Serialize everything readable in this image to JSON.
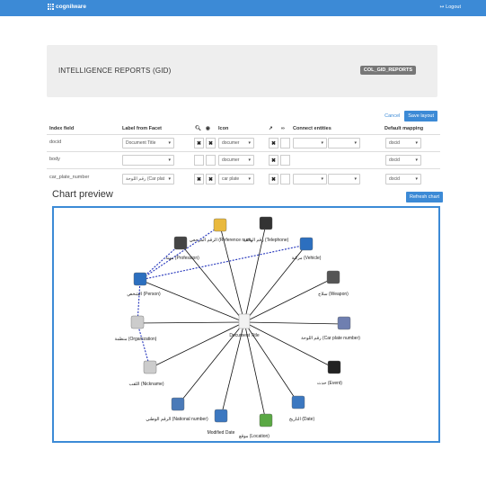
{
  "app": {
    "brand": "cognilware",
    "logout_label": "Logout"
  },
  "title_panel": {
    "title": "INTELLIGENCE REPORTS (GID)",
    "badge": "COL_GID_REPORTS"
  },
  "actions": {
    "cancel_label": "Cancel",
    "save_label": "Save layout"
  },
  "columns": {
    "index_field": "Index field",
    "label_from_facet": "Label from Facet",
    "icon": "Icon",
    "connect_entities": "Connect entities",
    "default_mapping": "Default mapping"
  },
  "rows": [
    {
      "index_field": "docid",
      "label": "Document Title",
      "icon": "documer",
      "mapping": "docid"
    },
    {
      "index_field": "body",
      "label": "",
      "icon": "documer",
      "mapping": "docid"
    },
    {
      "index_field": "car_plate_number",
      "label": "رقم اللوحة (Car plat",
      "icon": "car plate",
      "mapping": "docid"
    }
  ],
  "chart": {
    "title": "Chart preview",
    "refresh_label": "Refresh chart",
    "center_label": "Document Title",
    "nodes": [
      {
        "label": "الرقم المرجعي (Reference num",
        "icon": "folder-icon",
        "color": "#e9b93d"
      },
      {
        "label": "رقم الهاتف (Telephone)",
        "icon": "phone-icon",
        "color": "#333333"
      },
      {
        "label": "مركبة (Vehicle)",
        "icon": "car-icon",
        "color": "#2c6fbf"
      },
      {
        "label": "سلاح (Weapon)",
        "icon": "weapon-icon",
        "color": "#555555"
      },
      {
        "label": "رقم اللوحة (Car plate number)",
        "icon": "plate-icon",
        "color": "#6f7fb0"
      },
      {
        "label": "حدث (Event)",
        "icon": "clapper-icon",
        "color": "#222222"
      },
      {
        "label": "التاريخ (Date)",
        "icon": "calendar-icon",
        "color": "#3c78c0"
      },
      {
        "label": "موقع (Location)",
        "icon": "map-icon",
        "color": "#5aa844"
      },
      {
        "label": "Modified Date",
        "icon": "calendar-icon",
        "color": "#3c78c0"
      },
      {
        "label": "الرقم الوطني (National number)",
        "icon": "id-card-icon",
        "color": "#4a7ab8"
      },
      {
        "label": "اللقب (Nickname)",
        "icon": "document-icon",
        "color": "#cccccc"
      },
      {
        "label": "منظمة (Organization)",
        "icon": "document-icon",
        "color": "#cccccc"
      },
      {
        "label": "الشخص (Person)",
        "icon": "person-icon",
        "color": "#2c6fbf"
      },
      {
        "label": "مهنة (Profession)",
        "icon": "cash-register-icon",
        "color": "#444444"
      }
    ],
    "dashed_color": "#2233bb",
    "solid_color": "#111111"
  }
}
